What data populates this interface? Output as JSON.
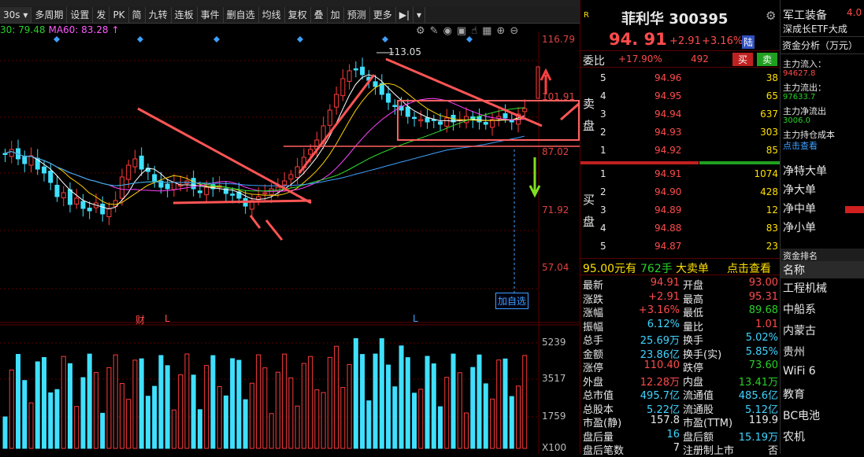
{
  "menu_strip": [
    "…",
    "…",
    "…",
    "…",
    "…",
    "…",
    "…",
    "…",
    "…",
    "…",
    "…"
  ],
  "toolbar": {
    "period": "30s",
    "period_icon": "chevron-down-icon",
    "items": [
      "多周期",
      "设置",
      "发",
      "PK",
      "简",
      "九转",
      "连板",
      "事件",
      "删自选",
      "均线",
      "复权",
      "叠",
      "加",
      "预测",
      "更多"
    ]
  },
  "ma": {
    "ma30": "30: 79.48",
    "ma60": "MA60: 83.28"
  },
  "price_axis": [
    "116.79",
    "101.91",
    "87.02",
    "71.92",
    "57.04"
  ],
  "volume_axis": [
    "5239",
    "3517",
    "1759",
    "X100"
  ],
  "chart": {
    "high_label": "113.05",
    "add_watch": "加自选",
    "markers": {
      "cai": "财",
      "l1": "L",
      "l2": "L"
    }
  },
  "stock": {
    "name": "菲利华",
    "code": "300395",
    "price": "94. 91",
    "change": "+2.91",
    "pct": "+3.16%",
    "tag": "陆",
    "board": "R"
  },
  "order": {
    "wb_label": "委比",
    "wb": "+17.90%",
    "wc": "492",
    "buy": "买",
    "sell": "卖",
    "sell_side": "卖盘",
    "buy_side": "买盘",
    "asks": [
      {
        "lv": "5",
        "p": "94.96",
        "v": "38"
      },
      {
        "lv": "4",
        "p": "94.95",
        "v": "65"
      },
      {
        "lv": "3",
        "p": "94.94",
        "v": "637"
      },
      {
        "lv": "2",
        "p": "94.93",
        "v": "303"
      },
      {
        "lv": "1",
        "p": "94.92",
        "v": "85"
      }
    ],
    "bids": [
      {
        "lv": "1",
        "p": "94.91",
        "v": "1074"
      },
      {
        "lv": "2",
        "p": "94.90",
        "v": "428"
      },
      {
        "lv": "3",
        "p": "94.89",
        "v": "12"
      },
      {
        "lv": "4",
        "p": "94.88",
        "v": "83"
      },
      {
        "lv": "5",
        "p": "94.87",
        "v": "23"
      }
    ]
  },
  "big_order": {
    "price": "95.00元有",
    "qty": "762手",
    "label": "大卖单",
    "action": "点击查看"
  },
  "quote": [
    [
      "最新",
      "94.91",
      "开盘",
      "93.00"
    ],
    [
      "涨跌",
      "+2.91",
      "最高",
      "95.31"
    ],
    [
      "涨幅",
      "+3.16%",
      "最低",
      "89.68"
    ],
    [
      "振幅",
      "6.12%",
      "量比",
      "1.01"
    ],
    [
      "总手",
      "25.69万",
      "换手",
      "5.02%"
    ],
    [
      "金额",
      "23.86亿",
      "换手(实)",
      "5.85%"
    ],
    [
      "涨停",
      "110.40",
      "跌停",
      "73.60"
    ],
    [
      "外盘",
      "12.28万",
      "内盘",
      "13.41万"
    ],
    [
      "总市值",
      "495.7亿",
      "流通值",
      "485.6亿"
    ],
    [
      "总股本",
      "5.22亿",
      "流通股",
      "5.12亿"
    ],
    [
      "市盈(静)",
      "157.8",
      "市盈(TTM)",
      "119.9"
    ],
    [
      "盘后量",
      "16",
      "盘后额",
      "15.19万"
    ],
    [
      "盘后笔数",
      "7",
      "注册制上市",
      "否"
    ]
  ],
  "side": {
    "sector": "军工装备",
    "sector_val": "4.0",
    "etf": "深成长ETF大成",
    "fund_title": "资金分析（万元）",
    "inflow_l": "主力流入：",
    "inflow": "94627.8",
    "outflow_l": "主力流出：",
    "outflow": "97633.7",
    "net_l": "主力净流出",
    "net": "3006.0",
    "cost_l": "主力持仓成本",
    "cost_link": "点击查看",
    "nets": [
      "净特大单",
      "净大单",
      "净中单",
      "净小单"
    ],
    "rank_title": "资金排名",
    "name_h": "名称",
    "ranks": [
      "工程机械",
      "中船系",
      "内蒙古",
      "贵州",
      "WiFi 6",
      "教育",
      "BC电池",
      "农机"
    ]
  }
}
